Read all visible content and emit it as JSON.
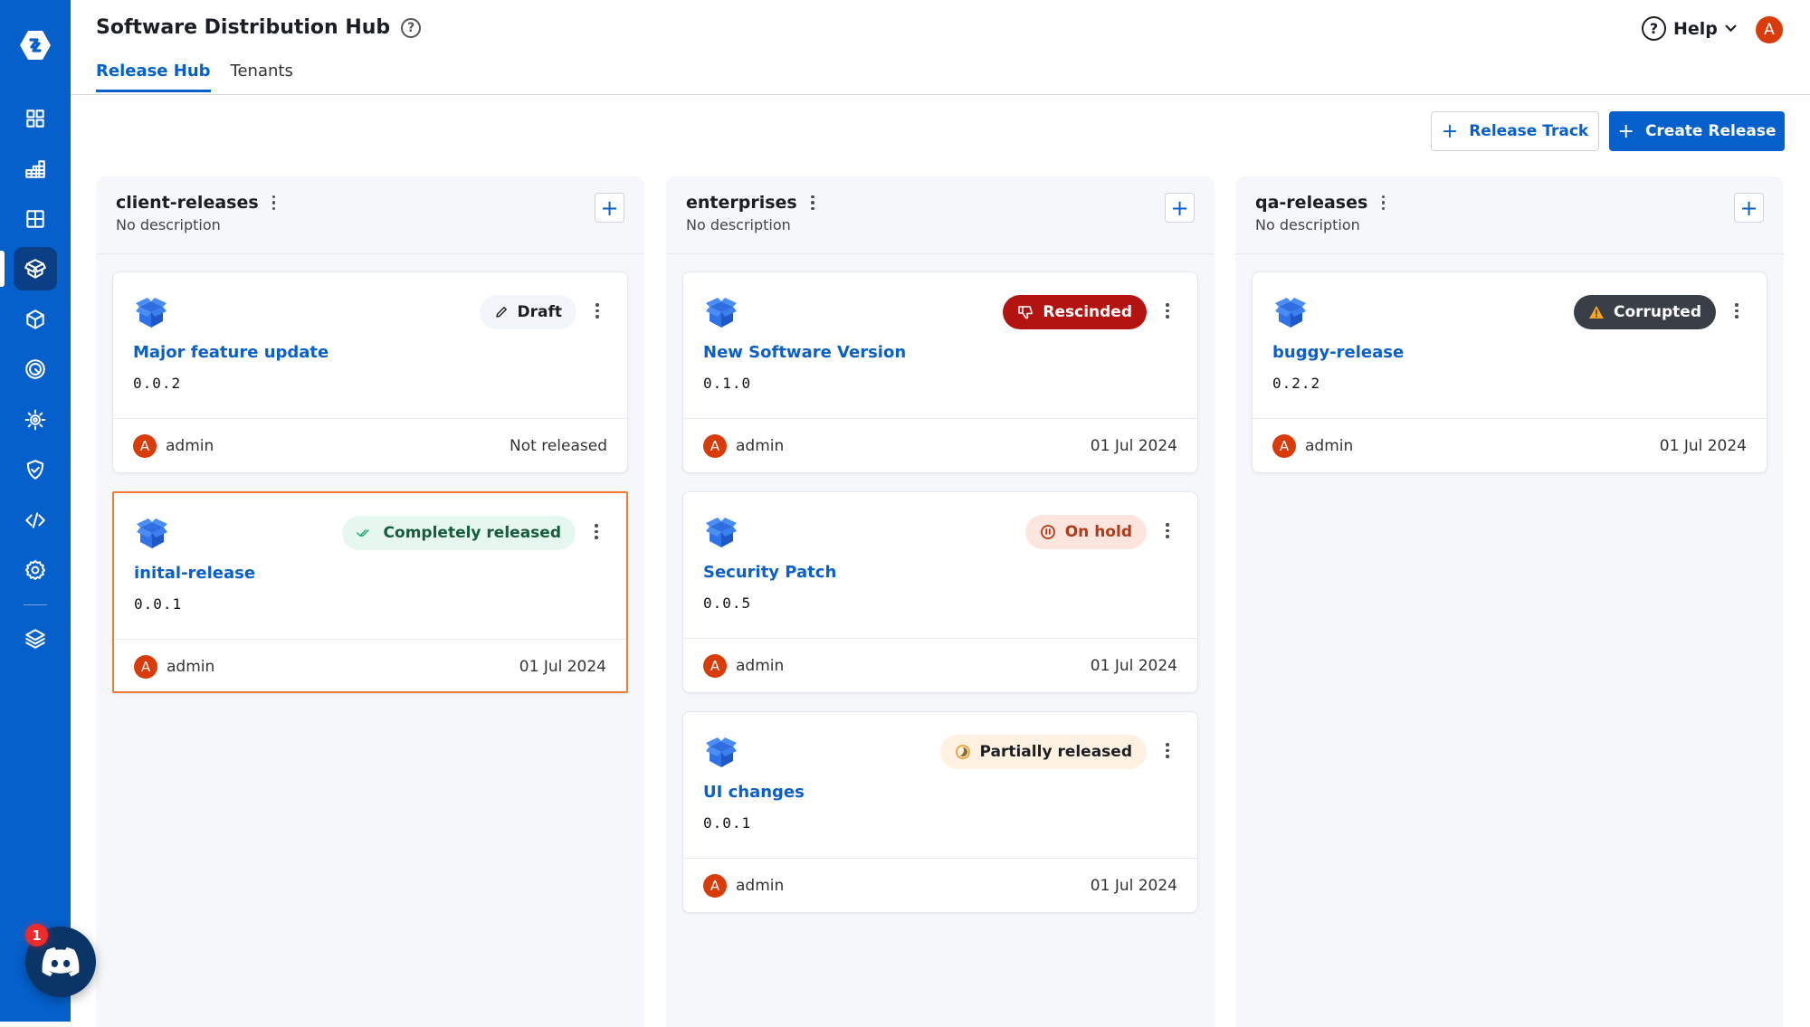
{
  "app": {
    "title": "Software Distribution Hub",
    "tabs": [
      {
        "label": "Release Hub",
        "active": true
      },
      {
        "label": "Tenants",
        "active": false
      }
    ],
    "help_label": "Help",
    "user_initial": "A",
    "brand_color": "#0560cc"
  },
  "sidebar": {
    "items": [
      {
        "icon": "dashboard-grid-icon"
      },
      {
        "icon": "bar-grid-icon"
      },
      {
        "icon": "table-grid-icon"
      },
      {
        "icon": "open-box-icon",
        "active": true
      },
      {
        "icon": "cube-icon"
      },
      {
        "icon": "target-icon"
      },
      {
        "icon": "sun-gear-icon"
      },
      {
        "icon": "shield-check-icon"
      },
      {
        "icon": "code-icon"
      },
      {
        "icon": "settings-icon"
      },
      {
        "icon": "layers-icon"
      }
    ],
    "discord_badge": "1"
  },
  "toolbar": {
    "release_track_label": "Release Track",
    "create_release_label": "Create Release"
  },
  "columns": [
    {
      "title": "client-releases",
      "description": "No description",
      "cards": [
        {
          "name": "Major feature update",
          "version": "0.0.2",
          "status": "Draft",
          "owner": "admin",
          "owner_initial": "A",
          "date": "Not released"
        },
        {
          "name": "inital-release",
          "version": "0.0.1",
          "status": "Completely released",
          "owner": "admin",
          "owner_initial": "A",
          "date": "01 Jul 2024",
          "selected": true
        }
      ]
    },
    {
      "title": "enterprises",
      "description": "No description",
      "cards": [
        {
          "name": "New Software Version",
          "version": "0.1.0",
          "status": "Rescinded",
          "owner": "admin",
          "owner_initial": "A",
          "date": "01 Jul 2024"
        },
        {
          "name": "Security Patch",
          "version": "0.0.5",
          "status": "On hold",
          "owner": "admin",
          "owner_initial": "A",
          "date": "01 Jul 2024"
        },
        {
          "name": "UI changes",
          "version": "0.0.1",
          "status": "Partially released",
          "owner": "admin",
          "owner_initial": "A",
          "date": "01 Jul 2024"
        }
      ]
    },
    {
      "title": "qa-releases",
      "description": "No description",
      "cards": [
        {
          "name": "buggy-release",
          "version": "0.2.2",
          "status": "Corrupted",
          "owner": "admin",
          "owner_initial": "A",
          "date": "01 Jul 2024"
        }
      ]
    }
  ],
  "status_colors": {
    "Draft": {
      "bg": "#f2f5f9",
      "fg": "#1b1f24"
    },
    "Completely released": {
      "bg": "#e6f7ef",
      "fg": "#145c3a"
    },
    "Rescinded": {
      "bg": "#b31412",
      "fg": "#ffffff"
    },
    "On hold": {
      "bg": "#fde5df",
      "fg": "#b23a17"
    },
    "Partially released": {
      "bg": "#fef1e1",
      "fg": "#1b1f24"
    },
    "Corrupted": {
      "bg": "#3a3f47",
      "fg": "#ffffff"
    }
  }
}
